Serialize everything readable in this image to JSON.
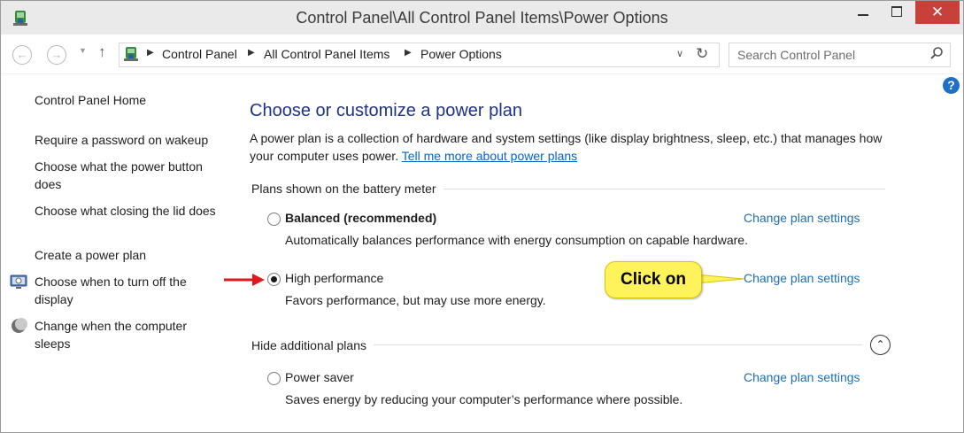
{
  "window": {
    "title": "Control Panel\\All Control Panel Items\\Power Options",
    "close_label": "✕",
    "title_icon": "control-panel-icon"
  },
  "nav": {
    "back_icon": "←",
    "forward_icon": "→",
    "history_dropdown": "▼",
    "up_icon": "↑",
    "crumb_sep": "▶",
    "breadcrumbs": [
      "Control Panel",
      "All Control Panel Items",
      "Power Options"
    ],
    "address_dropdown": "∨",
    "refresh_icon": "↻"
  },
  "search": {
    "placeholder": "Search Control Panel"
  },
  "help": {
    "label": "?"
  },
  "sidebar": {
    "items": [
      {
        "label": "Control Panel Home"
      },
      {
        "label": "Require a password on wakeup"
      },
      {
        "label": "Choose what the power button does"
      },
      {
        "label": "Choose what closing the lid does"
      },
      {
        "label": "Create a power plan"
      },
      {
        "label": "Choose when to turn off the display",
        "icon": "display-icon"
      },
      {
        "label": "Change when the computer sleeps",
        "icon": "moon-icon"
      }
    ]
  },
  "main": {
    "heading": "Choose or customize a power plan",
    "description": "A power plan is a collection of hardware and system settings (like display brightness, sleep, etc.) that manages how your computer uses power.",
    "learn_more_link": "Tell me more about power plans",
    "battery_group_label": "Plans shown on the battery meter",
    "hidden_group_label": "Hide additional plans",
    "collapse_icon": "⌃",
    "plans": [
      {
        "name": "Balanced (recommended)",
        "description": "Automatically balances performance with energy consumption on capable hardware.",
        "link": "Change plan settings",
        "selected": false
      },
      {
        "name": "High performance",
        "description": "Favors performance, but may use more energy.",
        "link": "Change plan settings",
        "selected": true
      },
      {
        "name": "Power saver",
        "description": "Saves energy by reducing your computer’s performance where possible.",
        "link": "Change plan settings",
        "selected": false
      }
    ]
  },
  "annotation": {
    "callout_text": "Click on",
    "colors": {
      "arrow": "#e0191e",
      "callout": "#fff35c",
      "heading": "#1e3287",
      "link": "#1f6fb2"
    }
  }
}
